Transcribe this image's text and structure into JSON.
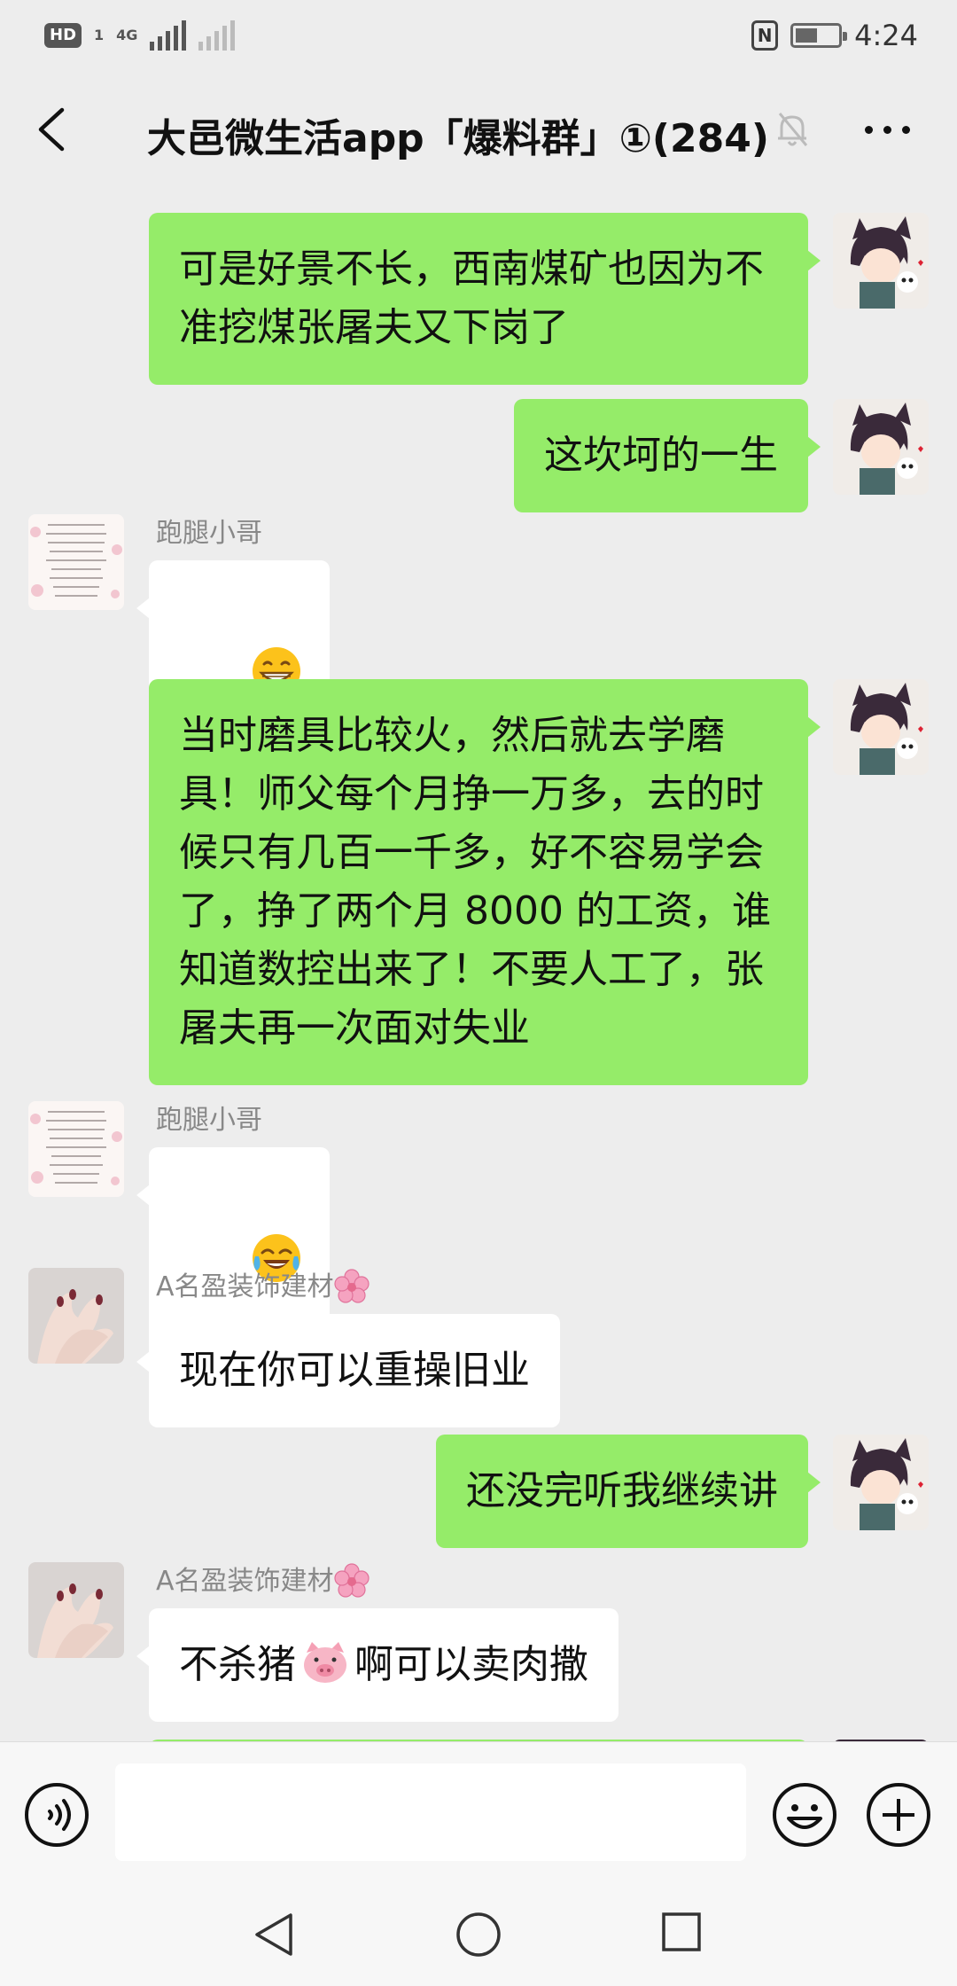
{
  "status_bar": {
    "hd": "HD",
    "sim": "1",
    "network": "4G",
    "time": "4:24",
    "nfc": "N"
  },
  "header": {
    "title": "大邑微生活app「爆料群」①(284)",
    "back_icon": "chevron-left-icon",
    "mute_icon": "bell-muted-icon",
    "more_icon": "more-dots-icon"
  },
  "messages": [
    {
      "side": "right",
      "text": "可是好景不长，西南煤矿也因为不\n准挖煤张屠夫又下岗了"
    },
    {
      "side": "right",
      "text": "这坎坷的一生"
    },
    {
      "side": "left",
      "sender": "跑腿小哥",
      "emoji": "grinning-face"
    },
    {
      "side": "right",
      "text": "当时磨具比较火，然后就去学磨\n具！师父每个月挣一万多，去的时\n候只有几百一千多，好不容易学会\n了，挣了两个月 8000 的工资，谁\n知道数控出来了！不要人工了，张\n屠夫再一次面对失业"
    },
    {
      "side": "left",
      "sender": "跑腿小哥",
      "emoji": "tears-of-joy"
    },
    {
      "side": "left",
      "sender": "A名盈装饰建材",
      "text": "现在你可以重操旧业"
    },
    {
      "side": "right",
      "text": "还没完听我继续讲"
    },
    {
      "side": "left",
      "sender": "A名盈装饰建材",
      "text_before": "不杀猪",
      "text_after": "啊可以卖肉撒"
    }
  ],
  "input": {
    "value": "",
    "voice_icon": "voice-icon",
    "emoji_icon": "emoji-icon",
    "plus_icon": "plus-icon"
  },
  "nav": {
    "back_icon": "nav-back-icon",
    "home_icon": "nav-home-icon",
    "recent_icon": "nav-recent-icon"
  },
  "colors": {
    "bubble_green": "#95ec69",
    "bubble_white": "#ffffff",
    "background": "#ededed"
  }
}
